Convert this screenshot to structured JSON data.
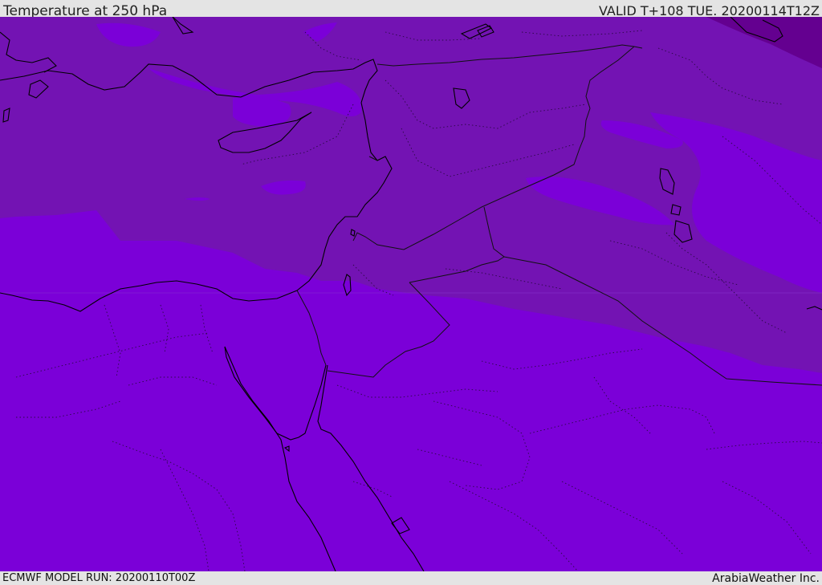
{
  "header": {
    "title": "Temperature at 250 hPa",
    "valid": "VALID T+108 TUE. 20200114T12Z"
  },
  "footer": {
    "model_run": "ECMWF MODEL RUN: 20200110T00Z",
    "credit": "ArabiaWeather Inc."
  },
  "map": {
    "colors": {
      "warm_fill": "#7b00d8",
      "cold_fill": "#7313b3",
      "coldest_fill": "#640090",
      "coastline": "#000000",
      "border": "#1a1a1a"
    }
  }
}
